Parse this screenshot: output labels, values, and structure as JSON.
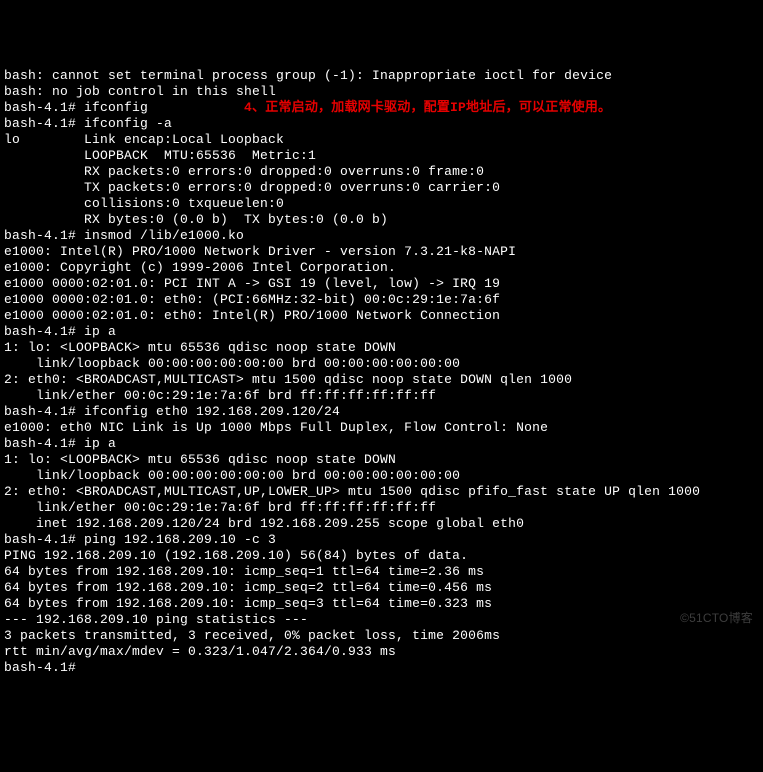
{
  "annotation": "4、正常启动，加载网卡驱动，配置IP地址后，可以正常使用。",
  "lines": [
    "bash: cannot set terminal process group (-1): Inappropriate ioctl for device",
    "bash: no job control in this shell",
    "bash-4.1# ifconfig",
    "bash-4.1# ifconfig -a",
    "lo        Link encap:Local Loopback",
    "          LOOPBACK  MTU:65536  Metric:1",
    "          RX packets:0 errors:0 dropped:0 overruns:0 frame:0",
    "          TX packets:0 errors:0 dropped:0 overruns:0 carrier:0",
    "          collisions:0 txqueuelen:0",
    "          RX bytes:0 (0.0 b)  TX bytes:0 (0.0 b)",
    "",
    "bash-4.1# insmod /lib/e1000.ko",
    "e1000: Intel(R) PRO/1000 Network Driver - version 7.3.21-k8-NAPI",
    "e1000: Copyright (c) 1999-2006 Intel Corporation.",
    "e1000 0000:02:01.0: PCI INT A -> GSI 19 (level, low) -> IRQ 19",
    "e1000 0000:02:01.0: eth0: (PCI:66MHz:32-bit) 00:0c:29:1e:7a:6f",
    "e1000 0000:02:01.0: eth0: Intel(R) PRO/1000 Network Connection",
    "bash-4.1# ip a",
    "1: lo: <LOOPBACK> mtu 65536 qdisc noop state DOWN",
    "    link/loopback 00:00:00:00:00:00 brd 00:00:00:00:00:00",
    "2: eth0: <BROADCAST,MULTICAST> mtu 1500 qdisc noop state DOWN qlen 1000",
    "    link/ether 00:0c:29:1e:7a:6f brd ff:ff:ff:ff:ff:ff",
    "bash-4.1# ifconfig eth0 192.168.209.120/24",
    "e1000: eth0 NIC Link is Up 1000 Mbps Full Duplex, Flow Control: None",
    "bash-4.1# ip a",
    "1: lo: <LOOPBACK> mtu 65536 qdisc noop state DOWN",
    "    link/loopback 00:00:00:00:00:00 brd 00:00:00:00:00:00",
    "2: eth0: <BROADCAST,MULTICAST,UP,LOWER_UP> mtu 1500 qdisc pfifo_fast state UP qlen 1000",
    "    link/ether 00:0c:29:1e:7a:6f brd ff:ff:ff:ff:ff:ff",
    "    inet 192.168.209.120/24 brd 192.168.209.255 scope global eth0",
    "bash-4.1# ping 192.168.209.10 -c 3",
    "PING 192.168.209.10 (192.168.209.10) 56(84) bytes of data.",
    "64 bytes from 192.168.209.10: icmp_seq=1 ttl=64 time=2.36 ms",
    "64 bytes from 192.168.209.10: icmp_seq=2 ttl=64 time=0.456 ms",
    "64 bytes from 192.168.209.10: icmp_seq=3 ttl=64 time=0.323 ms",
    "",
    "--- 192.168.209.10 ping statistics ---",
    "3 packets transmitted, 3 received, 0% packet loss, time 2006ms",
    "rtt min/avg/max/mdev = 0.323/1.047/2.364/0.933 ms",
    "bash-4.1#"
  ],
  "watermark": "©51CTO博客"
}
